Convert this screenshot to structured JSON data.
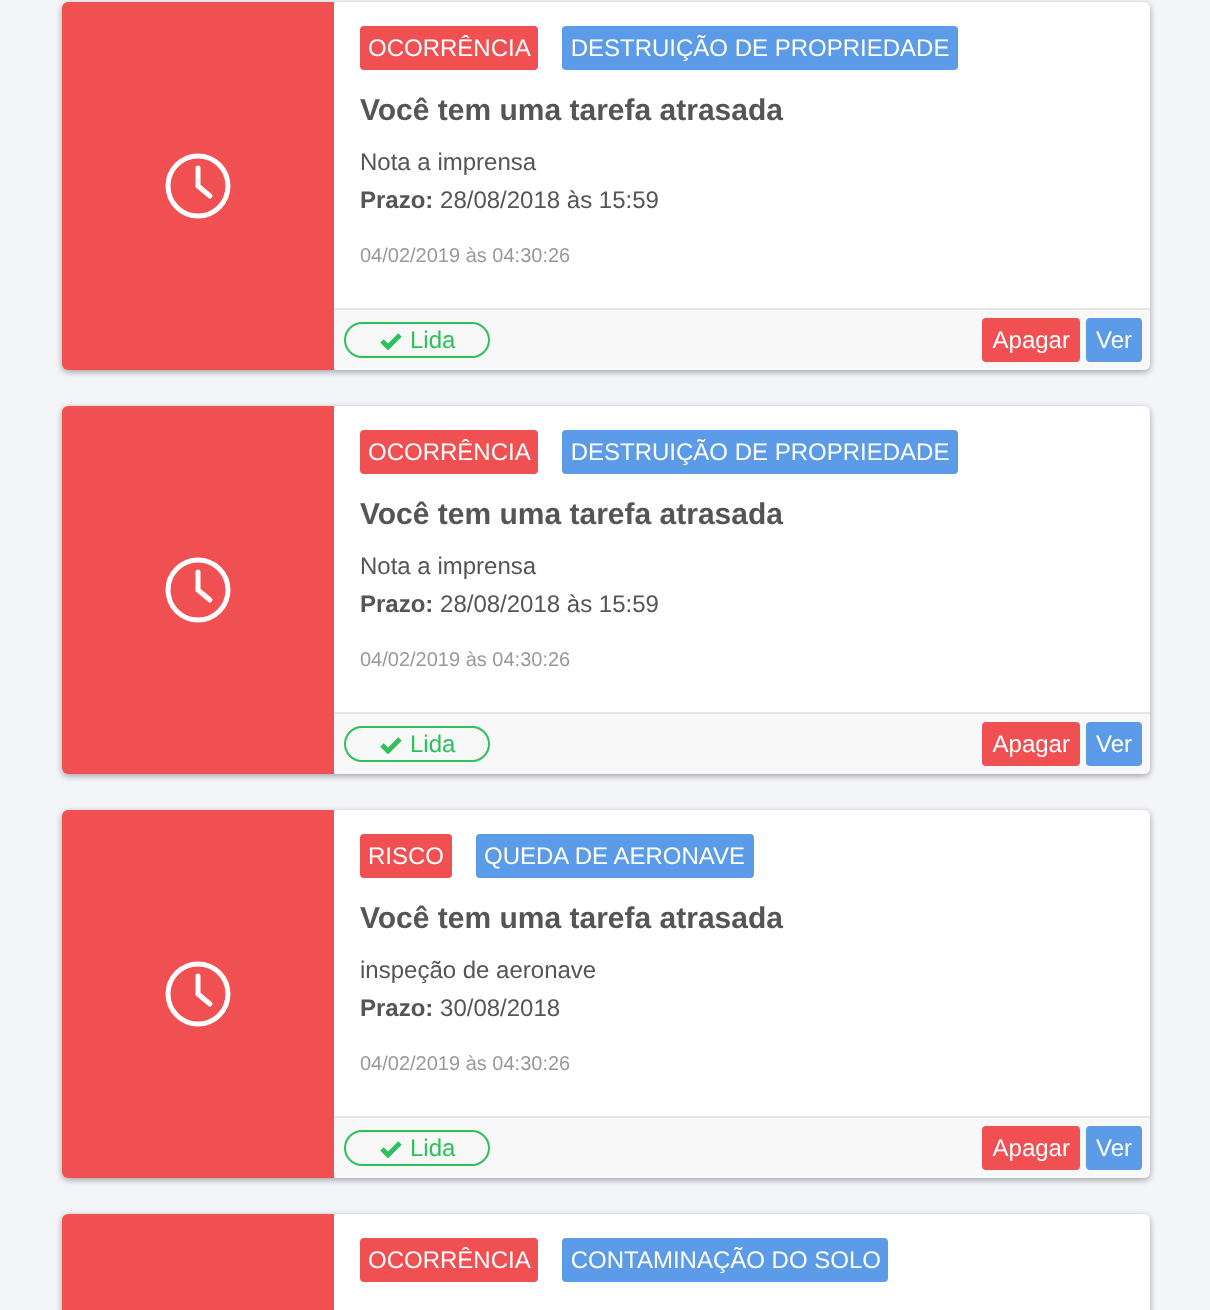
{
  "notifications": [
    {
      "tags": [
        {
          "label": "OCORRÊNCIA",
          "color": "#f05052"
        },
        {
          "label": "DESTRUIÇÃO DE PROPRIEDADE",
          "color": "#5b9be8"
        }
      ],
      "title": "Você tem uma tarefa atrasada",
      "description": "Nota a imprensa",
      "deadline": "**Prazo:** 28/08/2018 às 15:59",
      "timestamp": "04/02/2019 às 04:30:26",
      "status": "Lida",
      "actions": [
        {
          "label": "Apagar",
          "kind": "danger"
        },
        {
          "label": "Ver",
          "kind": "primary"
        }
      ]
    },
    {
      "tags": [
        {
          "label": "OCORRÊNCIA",
          "color": "#f05052"
        },
        {
          "label": "DESTRUIÇÃO DE PROPRIEDADE",
          "color": "#5b9be8"
        }
      ],
      "title": "Você tem uma tarefa atrasada",
      "description": "Nota a imprensa",
      "deadline": "**Prazo:** 28/08/2018 às 15:59",
      "timestamp": "04/02/2019 às 04:30:26",
      "status": "Lida",
      "actions": [
        {
          "label": "Apagar",
          "kind": "danger"
        },
        {
          "label": "Ver",
          "kind": "primary"
        }
      ]
    },
    {
      "tags": [
        {
          "label": "RISCO",
          "color": "#f05052"
        },
        {
          "label": "QUEDA DE AERONAVE",
          "color": "#5b9be8"
        }
      ],
      "title": "Você tem uma tarefa atrasada",
      "description": "inspeção de aeronave",
      "deadline": "**Prazo:** 30/08/2018",
      "timestamp": "04/02/2019 às 04:30:26",
      "status": "Lida",
      "actions": [
        {
          "label": "Apagar",
          "kind": "danger"
        },
        {
          "label": "Ver",
          "kind": "primary"
        }
      ]
    },
    {
      "tags": [
        {
          "label": "OCORRÊNCIA",
          "color": "#f05052"
        },
        {
          "label": "CONTAMINAÇÃO DO SOLO",
          "color": "#5b9be8"
        }
      ]
    }
  ]
}
